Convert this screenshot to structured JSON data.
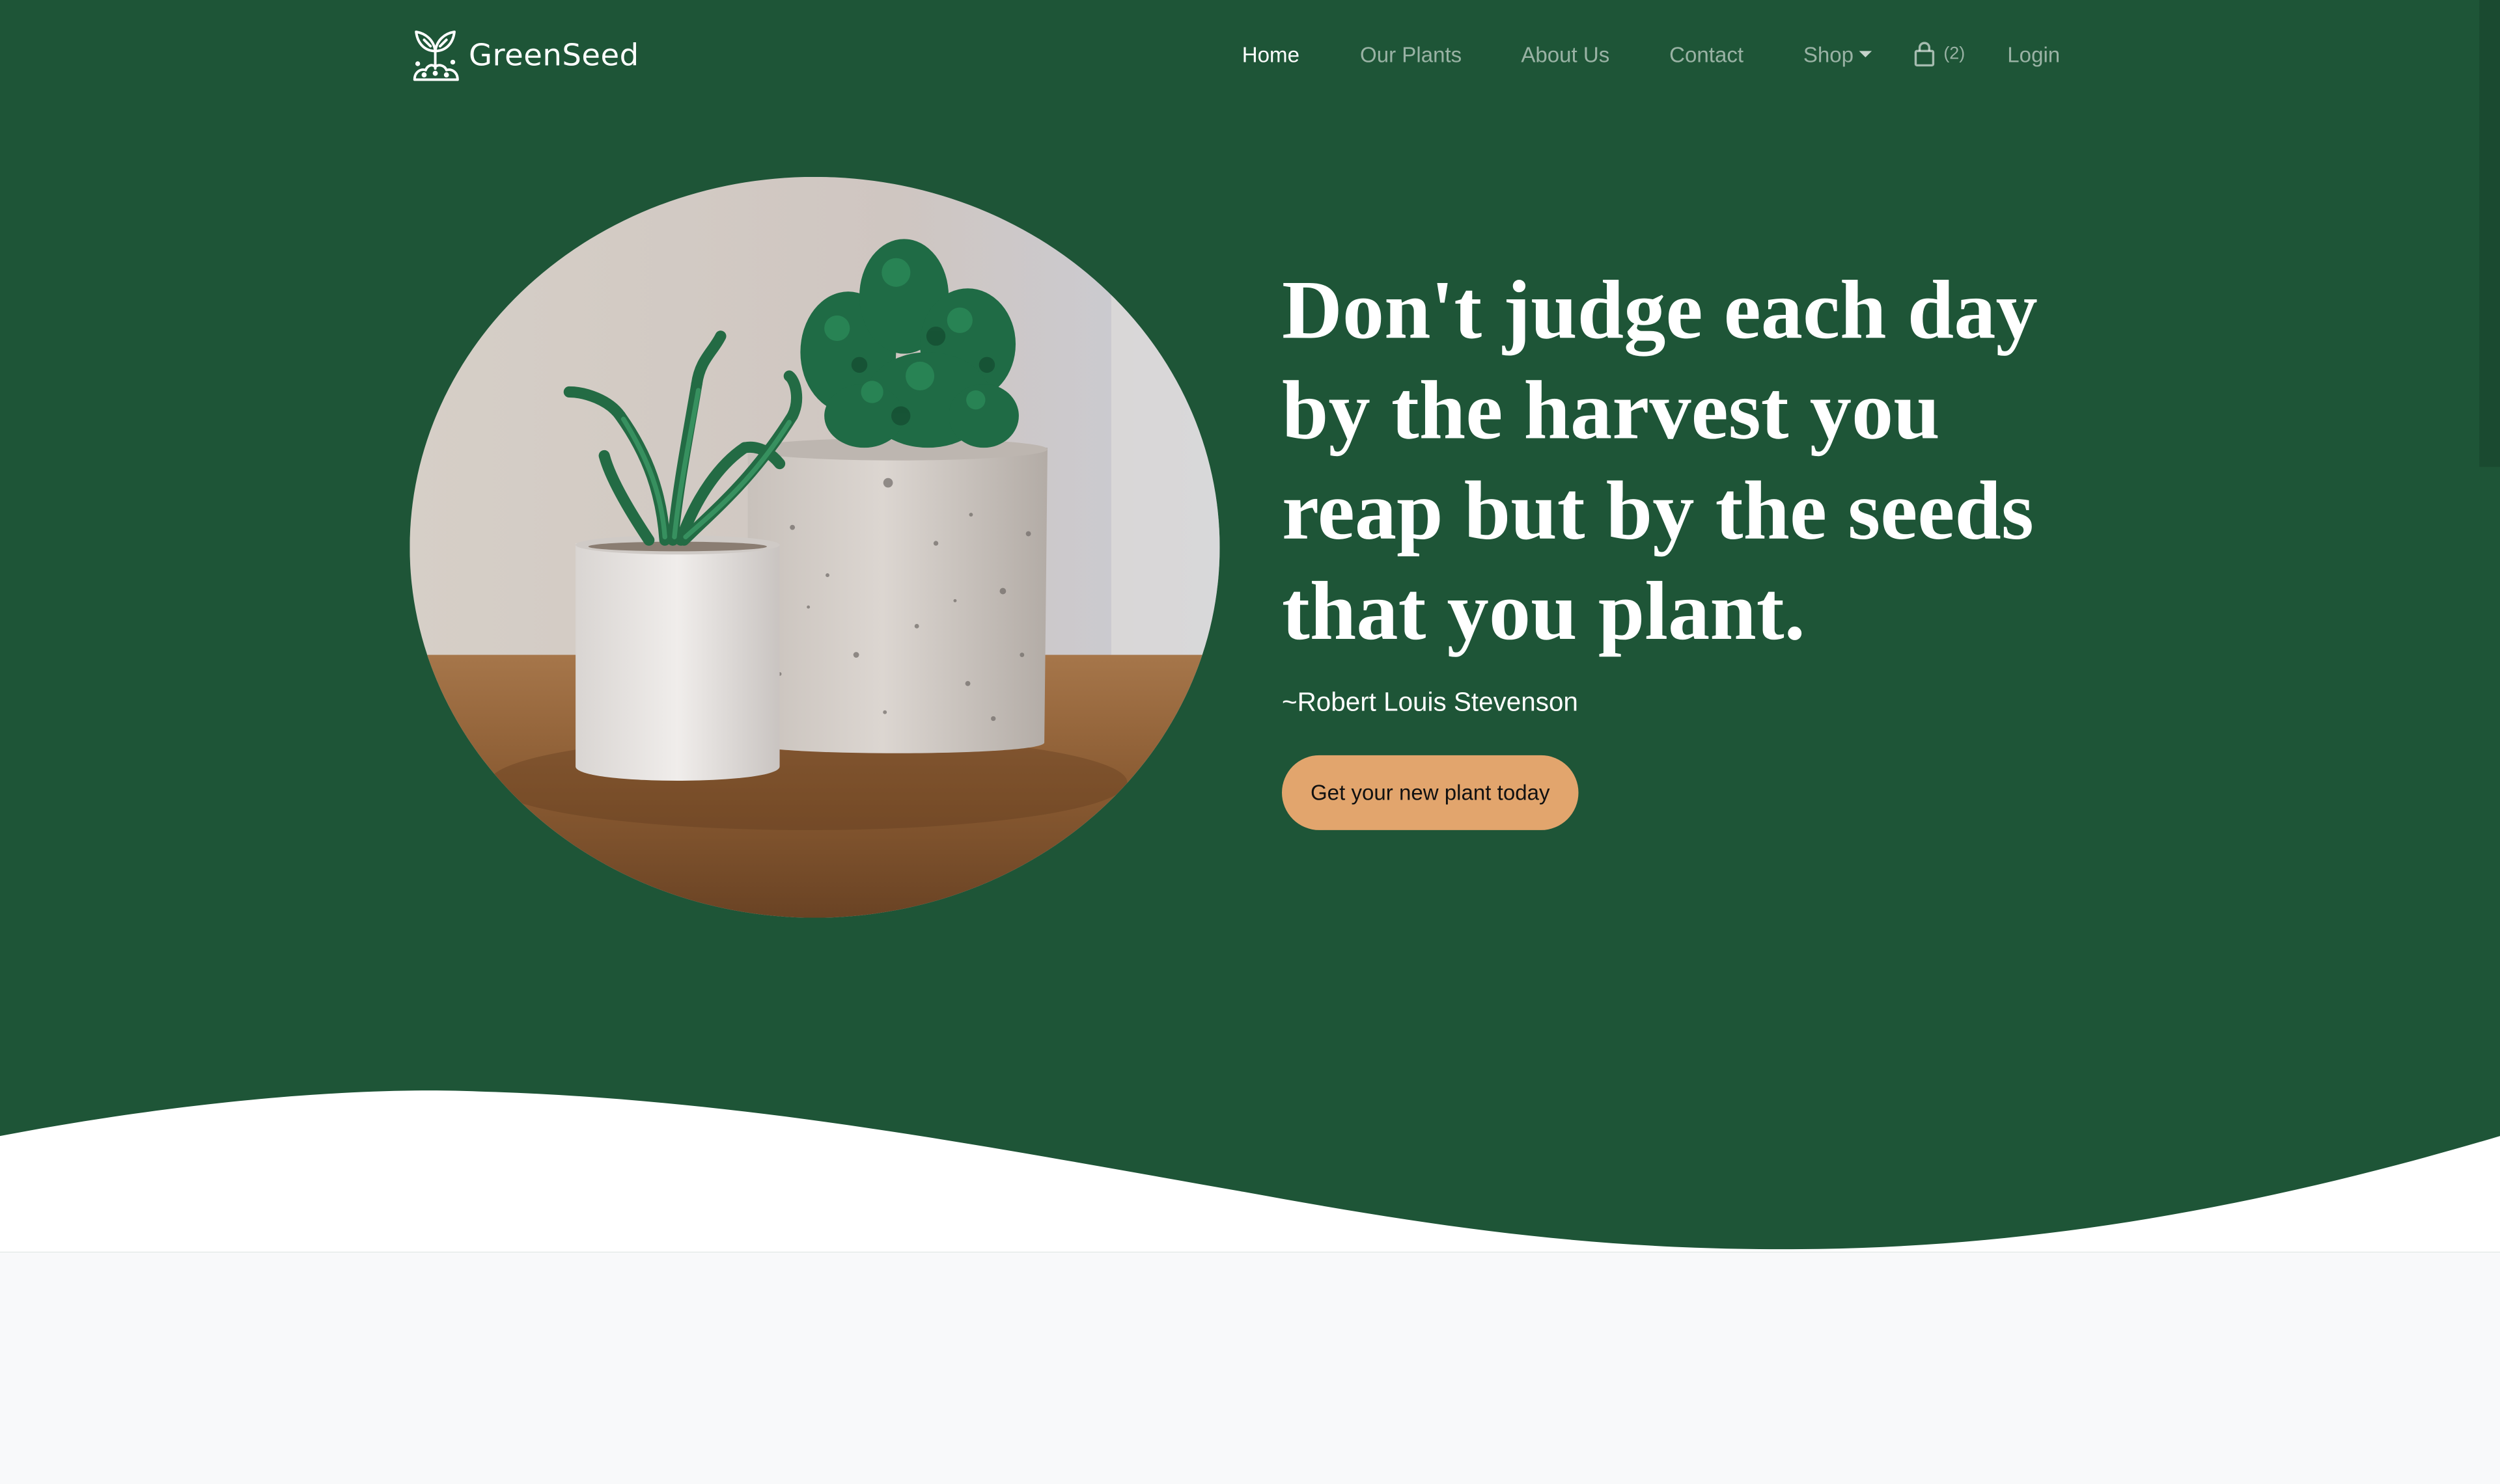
{
  "brand": {
    "name": "GreenSeed",
    "logo_icon": "sprout-icon"
  },
  "nav": {
    "items": [
      {
        "label": "Home",
        "active": true
      },
      {
        "label": "Our Plants",
        "active": false
      },
      {
        "label": "About Us",
        "active": false
      },
      {
        "label": "Contact",
        "active": false
      },
      {
        "label": "Shop",
        "active": false,
        "dropdown": true
      }
    ],
    "cart": {
      "icon": "shopping-bag-icon",
      "count": "(2)"
    },
    "login": "Login"
  },
  "hero": {
    "quote": "Don't judge each day by the harvest you reap but by the seeds that you plant.",
    "author": "~Robert Louis Stevenson",
    "cta": "Get your new plant today",
    "image": "potted-succulents-photo"
  },
  "colors": {
    "hero_background": "#1e5537",
    "cta_background": "#e2a56d",
    "page_background": "#f8f9fa"
  }
}
